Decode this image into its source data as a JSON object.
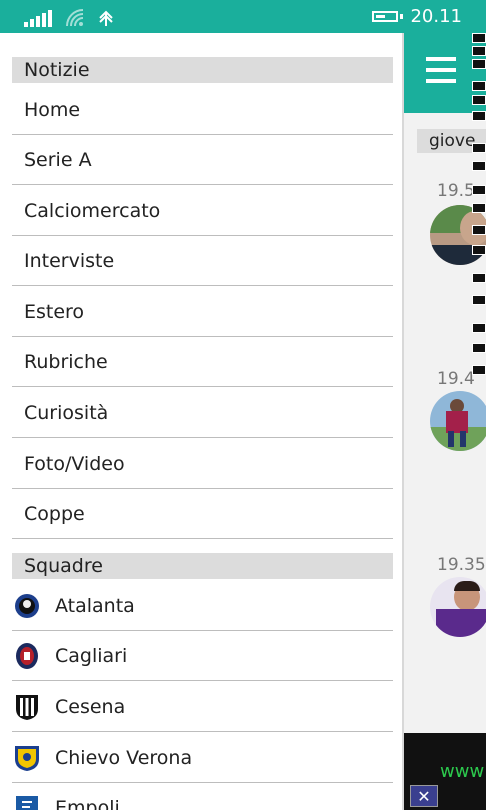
{
  "status_bar": {
    "time": "20.11",
    "signal_icon": "signal-bars-icon",
    "wifi_icon": "wifi-icon",
    "data_icon": "data-sync-icon",
    "battery_icon": "battery-icon",
    "battery_level": 0.5
  },
  "drawer": {
    "sections": [
      {
        "title": "Notizie"
      },
      {
        "title": "Squadre"
      }
    ],
    "news_items": [
      {
        "label": "Home"
      },
      {
        "label": "Serie A"
      },
      {
        "label": "Calciomercato"
      },
      {
        "label": "Interviste"
      },
      {
        "label": "Estero"
      },
      {
        "label": "Rubriche"
      },
      {
        "label": "Curiosità"
      },
      {
        "label": "Foto/Video"
      },
      {
        "label": "Coppe"
      }
    ],
    "teams": [
      {
        "label": "Atalanta",
        "icon": "atalanta-crest-icon",
        "colors": [
          "#1d3f8c",
          "#111111"
        ]
      },
      {
        "label": "Cagliari",
        "icon": "cagliari-crest-icon",
        "colors": [
          "#1b2a5e",
          "#b5202a"
        ]
      },
      {
        "label": "Cesena",
        "icon": "cesena-crest-icon",
        "colors": [
          "#111111",
          "#ffffff"
        ]
      },
      {
        "label": "Chievo Verona",
        "icon": "chievo-crest-icon",
        "colors": [
          "#1b3f8f",
          "#f2c500"
        ]
      },
      {
        "label": "Empoli",
        "icon": "empoli-crest-icon",
        "colors": [
          "#1a5aa5",
          "#ffffff"
        ]
      }
    ]
  },
  "content": {
    "menu_icon": "hamburger-menu-icon",
    "date_header": "giove",
    "news": [
      {
        "time": "19.5",
        "avatar": "player-avatar-1"
      },
      {
        "time": "19.4",
        "avatar": "player-avatar-2"
      },
      {
        "time": "19.35",
        "avatar": "player-avatar-3"
      }
    ],
    "ad_text": "www",
    "ad_close_icon": "close-ad-icon"
  },
  "colors": {
    "accent": "#1aaf9c",
    "section_bg": "#dcdcdc",
    "divider": "#bdbdbd",
    "ad_text": "#2cc94d"
  }
}
